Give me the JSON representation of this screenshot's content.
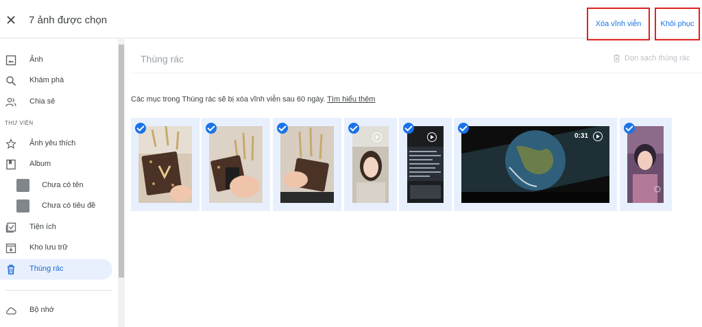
{
  "topbar": {
    "close_icon": "close-icon",
    "selection_title": "7 ảnh được chọn",
    "delete_forever_label": "Xóa vĩnh viễn",
    "restore_label": "Khôi phục"
  },
  "sidebar": {
    "items": [
      {
        "label": "Ảnh",
        "icon": "photo-icon"
      },
      {
        "label": "Khám phá",
        "icon": "search-icon"
      },
      {
        "label": "Chia sẻ",
        "icon": "people-icon"
      }
    ],
    "library_label": "THƯ VIỆN",
    "library_items": [
      {
        "label": "Ảnh yêu thích",
        "icon": "star-icon"
      },
      {
        "label": "Album",
        "icon": "album-icon"
      }
    ],
    "albums": [
      {
        "label": "Chưa có tên"
      },
      {
        "label": "Chưa có tiêu đề"
      }
    ],
    "more_items": [
      {
        "label": "Tiện ích",
        "icon": "utilities-icon"
      },
      {
        "label": "Kho lưu trữ",
        "icon": "archive-icon"
      },
      {
        "label": "Thùng rác",
        "icon": "trash-icon",
        "active": true
      },
      {
        "label": "Bộ nhớ",
        "icon": "cloud-icon"
      }
    ]
  },
  "main": {
    "title": "Thùng rác",
    "empty_trash_label": "Dọn sạch thùng rác",
    "info_text": "Các mục trong Thùng rác sẽ bị xóa vĩnh viễn sau 60 ngày.",
    "learn_more_label": "Tìm hiểu thêm",
    "video_duration": "0:31"
  },
  "colors": {
    "accent": "#1a73e8",
    "selected_tile_bg": "#e8f0fe",
    "highlight_box": "#e02020"
  }
}
